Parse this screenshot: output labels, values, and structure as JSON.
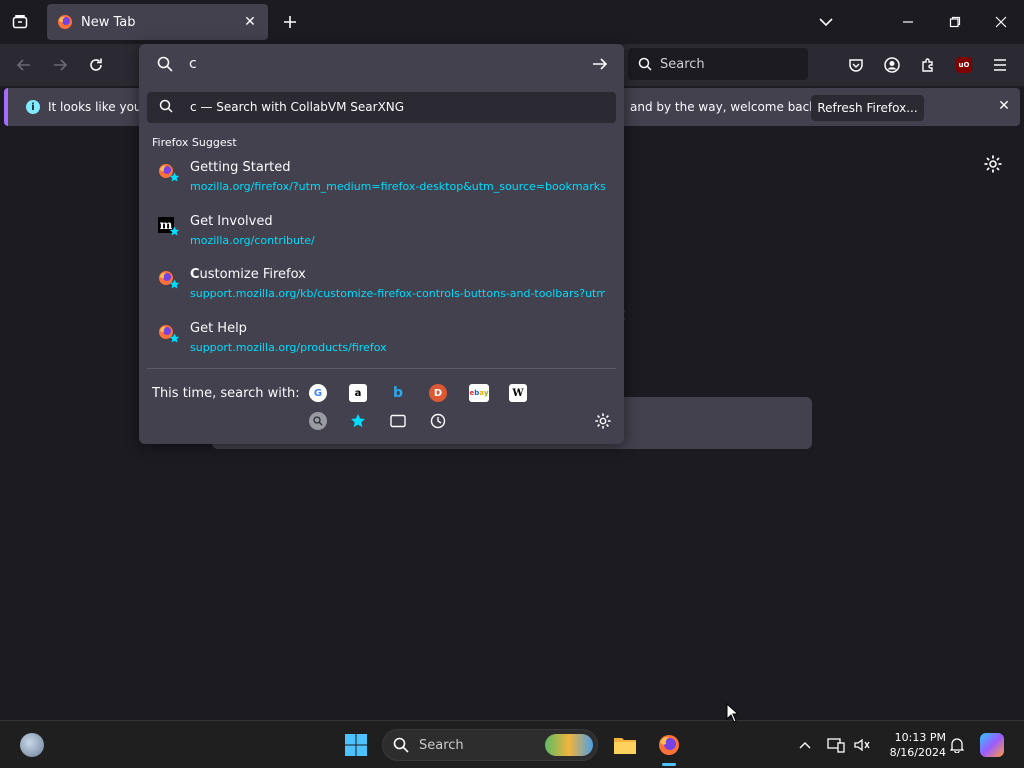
{
  "tabs": [
    {
      "title": "New Tab"
    }
  ],
  "navbar": {
    "search_placeholder": "Search"
  },
  "notification": {
    "message_left": "It looks like you ha",
    "message_right": "and by the way, welcome back!",
    "button_label": "Refresh Firefox..."
  },
  "urlbar": {
    "typed_text": "c",
    "heuristic_text": "c — Search with CollabVM SearXNG",
    "group_label": "Firefox Suggest",
    "results": [
      {
        "title_bold": "",
        "title_rest": "Getting Started",
        "url": "mozilla.org/firefox/?utm_medium=firefox-desktop&utm_source=bookmarks-t",
        "icon": "firefox-icon"
      },
      {
        "title_bold": "",
        "title_rest": "Get Involved",
        "url": "mozilla.org/contribute/",
        "icon": "mozilla-icon"
      },
      {
        "title_bold": "C",
        "title_rest": "ustomize Firefox",
        "url": "support.mozilla.org/kb/customize-firefox-controls-buttons-and-toolbars?utm",
        "icon": "firefox-icon"
      },
      {
        "title_bold": "",
        "title_rest": "Get Help",
        "url": "support.mozilla.org/products/firefox",
        "icon": "firefox-icon"
      }
    ],
    "oneoff_label": "This time, search with:",
    "engines_row1": [
      "google-icon",
      "amazon-icon",
      "bing-icon",
      "duckduckgo-icon",
      "ebay-icon",
      "wikipedia-icon"
    ],
    "engines_row2": [
      "searxng-icon",
      "bookmarks-icon",
      "tabs-icon",
      "history-icon"
    ]
  },
  "taskbar": {
    "search_placeholder": "Search",
    "time": "10:13 PM",
    "date": "8/16/2024"
  },
  "colors": {
    "accent_link": "#00ddff",
    "popup_bg": "#42414d",
    "page_bg": "#1c1b22",
    "notification_stripe": "#a66bff"
  }
}
